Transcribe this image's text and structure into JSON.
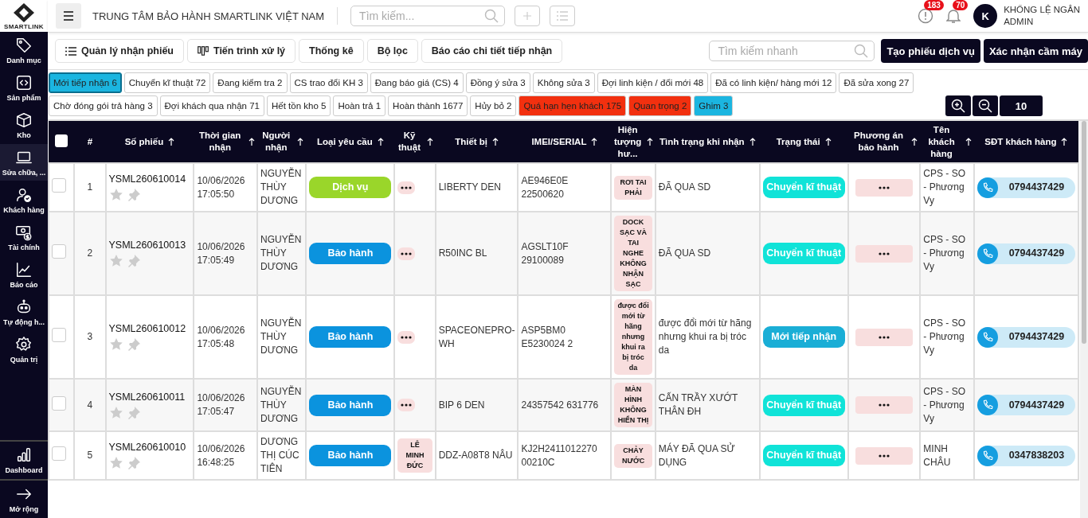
{
  "brand": {
    "name": "SMARTLINK"
  },
  "header": {
    "title": "TRUNG TÂM BẢO HÀNH SMARTLINK VIỆT NAM",
    "search": {
      "placeholder": "Tìm kiếm..."
    },
    "alerts_badge": "183",
    "notifications_badge": "70",
    "user": {
      "initial": "K",
      "name": "KHỔNG LỆ NGÂN",
      "role": "ADMIN"
    }
  },
  "sidebar": {
    "items": [
      {
        "label": "Danh mục",
        "kind": "tag",
        "selected": false
      },
      {
        "label": "Sản phẩm",
        "kind": "code",
        "selected": false
      },
      {
        "label": "Kho",
        "kind": "box",
        "selected": false
      },
      {
        "label": "Sửa chữa, ...",
        "kind": "laptop",
        "selected": true
      },
      {
        "label": "Khách hàng",
        "kind": "user",
        "selected": false
      },
      {
        "label": "Tài chính",
        "kind": "money",
        "selected": false
      },
      {
        "label": "Báo cáo",
        "kind": "chart",
        "selected": false
      },
      {
        "label": "Tự động h...",
        "kind": "robot",
        "selected": false
      },
      {
        "label": "Quản trị",
        "kind": "gear",
        "selected": false
      }
    ],
    "bottom_items": [
      {
        "label": "Dashboard",
        "kind": "bars"
      },
      {
        "label": "Mở rộng",
        "kind": "arrow"
      }
    ]
  },
  "toolbar": {
    "tabs": [
      {
        "label": "Quản lý nhận phiếu",
        "kind": "list"
      },
      {
        "label": "Tiến trình xử lý",
        "kind": "columns"
      },
      {
        "label": "Thống kê",
        "kind": "plain"
      },
      {
        "label": "Bộ lọc",
        "kind": "plain"
      },
      {
        "label": "Báo cáo chi tiết tiếp nhận",
        "kind": "plain"
      }
    ],
    "quick_search": {
      "placeholder": "Tìm kiếm nhanh"
    },
    "buttons": [
      "Tạo phiếu dịch vụ",
      "Xác nhận cầm máy"
    ]
  },
  "filters": [
    {
      "label": "Mới tiếp nhận 6",
      "color": "#1bb5e0",
      "selected": true
    },
    {
      "label": "Chuyển kĩ thuật 72",
      "color": "#ffffff",
      "selected": false
    },
    {
      "label": "Đang kiểm tra 2",
      "color": "#ffffff",
      "selected": false
    },
    {
      "label": "CS trao đổi KH 3",
      "color": "#ffffff",
      "selected": false
    },
    {
      "label": "Đang báo giá (CS) 4",
      "color": "#ffffff",
      "selected": false
    },
    {
      "label": "Đồng ý sửa 3",
      "color": "#ffffff",
      "selected": false
    },
    {
      "label": "Không sửa 3",
      "color": "#ffffff",
      "selected": false
    },
    {
      "label": "Đợi linh kiện / đổi mới 48",
      "color": "#ffffff",
      "selected": false
    },
    {
      "label": "Đã có linh kiện/ hàng mới 12",
      "color": "#ffffff",
      "selected": false
    },
    {
      "label": "Đã sửa xong 27",
      "color": "#ffffff",
      "selected": false
    },
    {
      "label": "Chờ đóng gói trả hàng 3",
      "color": "#ffffff",
      "selected": false
    },
    {
      "label": "Đợi khách qua nhận 71",
      "color": "#ffffff",
      "selected": false
    },
    {
      "label": "Hết tồn kho 5",
      "color": "#ffffff",
      "selected": false
    },
    {
      "label": "Hoàn trả 1",
      "color": "#ffffff",
      "selected": false
    },
    {
      "label": "Hoàn thành 1677",
      "color": "#ffffff",
      "selected": false
    },
    {
      "label": "Hủy bỏ 2",
      "color": "#ffffff",
      "selected": false
    },
    {
      "label": "Quá hạn hẹn khách 175",
      "color": "#f2300f",
      "selected": false
    },
    {
      "label": "Quan trọng 2",
      "color": "#f2300f",
      "selected": false
    },
    {
      "label": "Ghim 3",
      "color": "#1bb5e0",
      "selected": false
    }
  ],
  "page_size": "10",
  "table": {
    "all_checked": false,
    "columns": [
      "#",
      "Số phiếu",
      "Thời gian nhận",
      "Người nhận",
      "Loại yêu cầu",
      "Kỹ thuật",
      "Thiết bị",
      "IMEI/SERIAL",
      "Hiện tượng hư...",
      "Tình trạng khi nhận",
      "Trạng thái",
      "Phương án bảo hành",
      "Tên khách hàng",
      "SĐT khách hàng"
    ],
    "rows": [
      {
        "checked": false,
        "index": "1",
        "code": "YSML260610014",
        "starred": false,
        "pinned": false,
        "date": "10/06/2026",
        "time": "17:05:50",
        "receiver": "NGUYỄN THÙY DƯƠNG",
        "request": {
          "label": "Dịch vụ",
          "kind": "service"
        },
        "device": "LIBERTY DEN",
        "imei": "AE946E0E 22500620",
        "symptom": "RƠI TAI PHẢI",
        "condition": "ĐÃ QUA SD",
        "status": {
          "label": "Chuyển kĩ thuật",
          "kind": "technical"
        },
        "customer": "CPS - SO - Phương Vy",
        "phone": "0794437429"
      },
      {
        "checked": false,
        "index": "2",
        "code": "YSML260610013",
        "starred": false,
        "pinned": false,
        "date": "10/06/2026",
        "time": "17:05:49",
        "receiver": "NGUYỄN THÙY DƯƠNG",
        "request": {
          "label": "Bảo hành",
          "kind": "warranty"
        },
        "device": "R50INC BL",
        "imei": "AGSLT10F 29100089",
        "symptom": "DOCK SẠC VÀ TAI NGHE KHÔNG NHẬN SẠC",
        "condition": "ĐÃ QUA SD",
        "status": {
          "label": "Chuyển kĩ thuật",
          "kind": "technical"
        },
        "customer": "CPS - SO - Phương Vy",
        "phone": "0794437429"
      },
      {
        "checked": false,
        "index": "3",
        "code": "YSML260610012",
        "starred": false,
        "pinned": false,
        "date": "10/06/2026",
        "time": "17:05:48",
        "receiver": "NGUYỄN THÙY DƯƠNG",
        "request": {
          "label": "Bảo hành",
          "kind": "warranty"
        },
        "device": "SPACEONEPRO-WH",
        "imei": "ASP5BM0 E5230024 2",
        "symptom": "được đổi mới từ hãng nhưng khui ra bị tróc da",
        "condition": "được đổi mới từ hãng nhưng khui ra bị tróc da",
        "status": {
          "label": "Mới tiếp nhận",
          "kind": "new"
        },
        "customer": "CPS - SO - Phương Vy",
        "phone": "0794437429"
      },
      {
        "checked": false,
        "index": "4",
        "code": "YSML260610011",
        "starred": false,
        "pinned": false,
        "date": "10/06/2026",
        "time": "17:05:47",
        "receiver": "NGUYỄN THÙY DƯƠNG",
        "request": {
          "label": "Bảo hành",
          "kind": "warranty"
        },
        "device": "BIP 6 DEN",
        "imei": "24357542 631776",
        "symptom": "MÀN HÌNH KHÔNG HIỂN THỊ",
        "condition": "CẤN TRẦY XƯỚT THÂN ĐH",
        "status": {
          "label": "Chuyển kĩ thuật",
          "kind": "technical"
        },
        "customer": "CPS - SO - Phương Vy",
        "phone": "0794437429"
      },
      {
        "checked": false,
        "index": "5",
        "code": "YSML260610010",
        "starred": false,
        "pinned": false,
        "date": "10/06/2026",
        "time": "16:48:25",
        "receiver": "DƯƠNG THỊ CÚC TIÊN",
        "request": {
          "label": "Bảo hành",
          "kind": "warranty"
        },
        "technician": "LÊ MINH ĐỨC",
        "device": "DDZ-A08T8 NÂU",
        "imei": "KJ2H2411012270 00210C",
        "symptom": "CHẢY NƯỚC",
        "condition": "MÁY ĐÃ QUA SỬ DỤNG",
        "status": {
          "label": "Chuyển kĩ thuật",
          "kind": "technical"
        },
        "customer": "MINH CHÂU",
        "phone": "0347838203"
      }
    ]
  }
}
